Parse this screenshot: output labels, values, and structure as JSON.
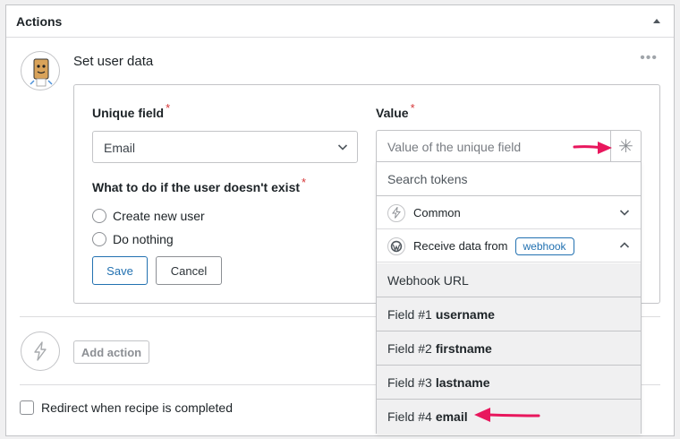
{
  "panel": {
    "title": "Actions"
  },
  "action": {
    "title": "Set user data",
    "more": "•••"
  },
  "form": {
    "unique_field_label": "Unique field",
    "required_mark": "*",
    "unique_field_value": "Email",
    "value_label": "Value",
    "value_placeholder": "Value of the unique field",
    "token_glyph": "✳",
    "not_exist_label": "What to do if the user doesn't exist",
    "options": [
      "Create new user",
      "Do nothing"
    ],
    "save_label": "Save",
    "cancel_label": "Cancel"
  },
  "dropdown": {
    "search_placeholder": "Search tokens",
    "groups": [
      {
        "label": "Common",
        "icon": "bolt-icon",
        "expanded": false
      },
      {
        "label": "Receive data from",
        "badge": "webhook",
        "icon": "wordpress-icon",
        "expanded": true
      }
    ],
    "items": [
      {
        "prefix": "Webhook URL",
        "name": ""
      },
      {
        "prefix": "Field #1",
        "name": "username"
      },
      {
        "prefix": "Field #2",
        "name": "firstname"
      },
      {
        "prefix": "Field #3",
        "name": "lastname"
      },
      {
        "prefix": "Field #4",
        "name": "email"
      }
    ]
  },
  "footer": {
    "add_action_label": "Add action",
    "redirect_label": "Redirect when recipe is completed"
  },
  "colors": {
    "accent": "#2271b1",
    "required": "#d63638",
    "annotation_arrow": "#e8175d"
  }
}
